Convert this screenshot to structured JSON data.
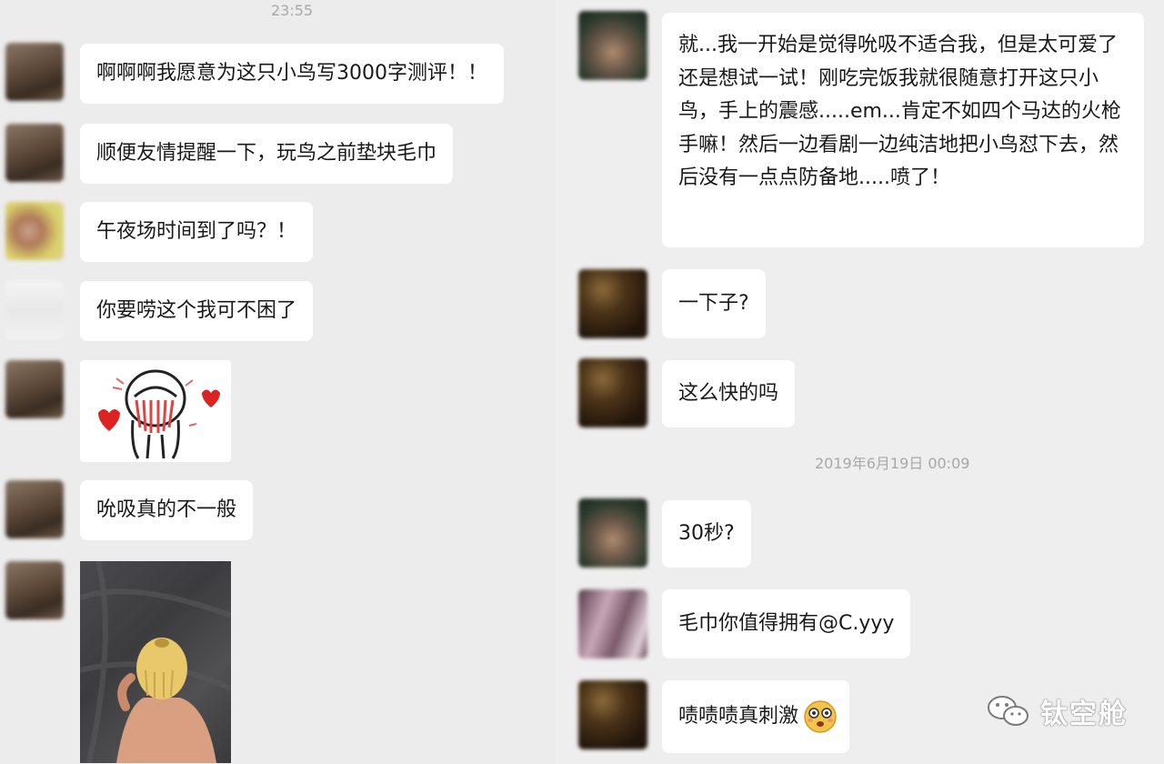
{
  "left": {
    "timestamp": "23:55",
    "messages": [
      {
        "text": "啊啊啊我愿意为这只小鸟写3000字测评！！"
      },
      {
        "text": "顺便友情提醒一下，玩鸟之前垫块毛巾"
      },
      {
        "text": "午夜场时间到了吗？！"
      },
      {
        "text": "你要唠这个我可不困了"
      },
      {
        "text": "吮吸真的不一般"
      }
    ]
  },
  "right": {
    "messages": [
      {
        "text": "就...我一开始是觉得吮吸不适合我，但是太可爱了还是想试一试！刚吃完饭我就很随意打开这只小鸟，手上的震感.....em...肯定不如四个马达的火枪手嘛！然后一边看剧一边纯洁地把小鸟怼下去，然后没有一点点防备地.....喷了！"
      },
      {
        "text": "一下子?"
      },
      {
        "text": "这么快的吗"
      },
      {
        "text": "30秒?"
      },
      {
        "text": "毛巾你值得拥有@C.yyy"
      },
      {
        "text": "啧啧啧真刺激"
      }
    ],
    "timestamp": "2019年6月19日 00:09"
  },
  "watermark": {
    "text": "钛空舱",
    "icon": "wechat-icon"
  },
  "colors": {
    "bubble": "#ffffff",
    "background": "#ededed",
    "timestamp": "#a8a8a8",
    "text": "#191919"
  }
}
